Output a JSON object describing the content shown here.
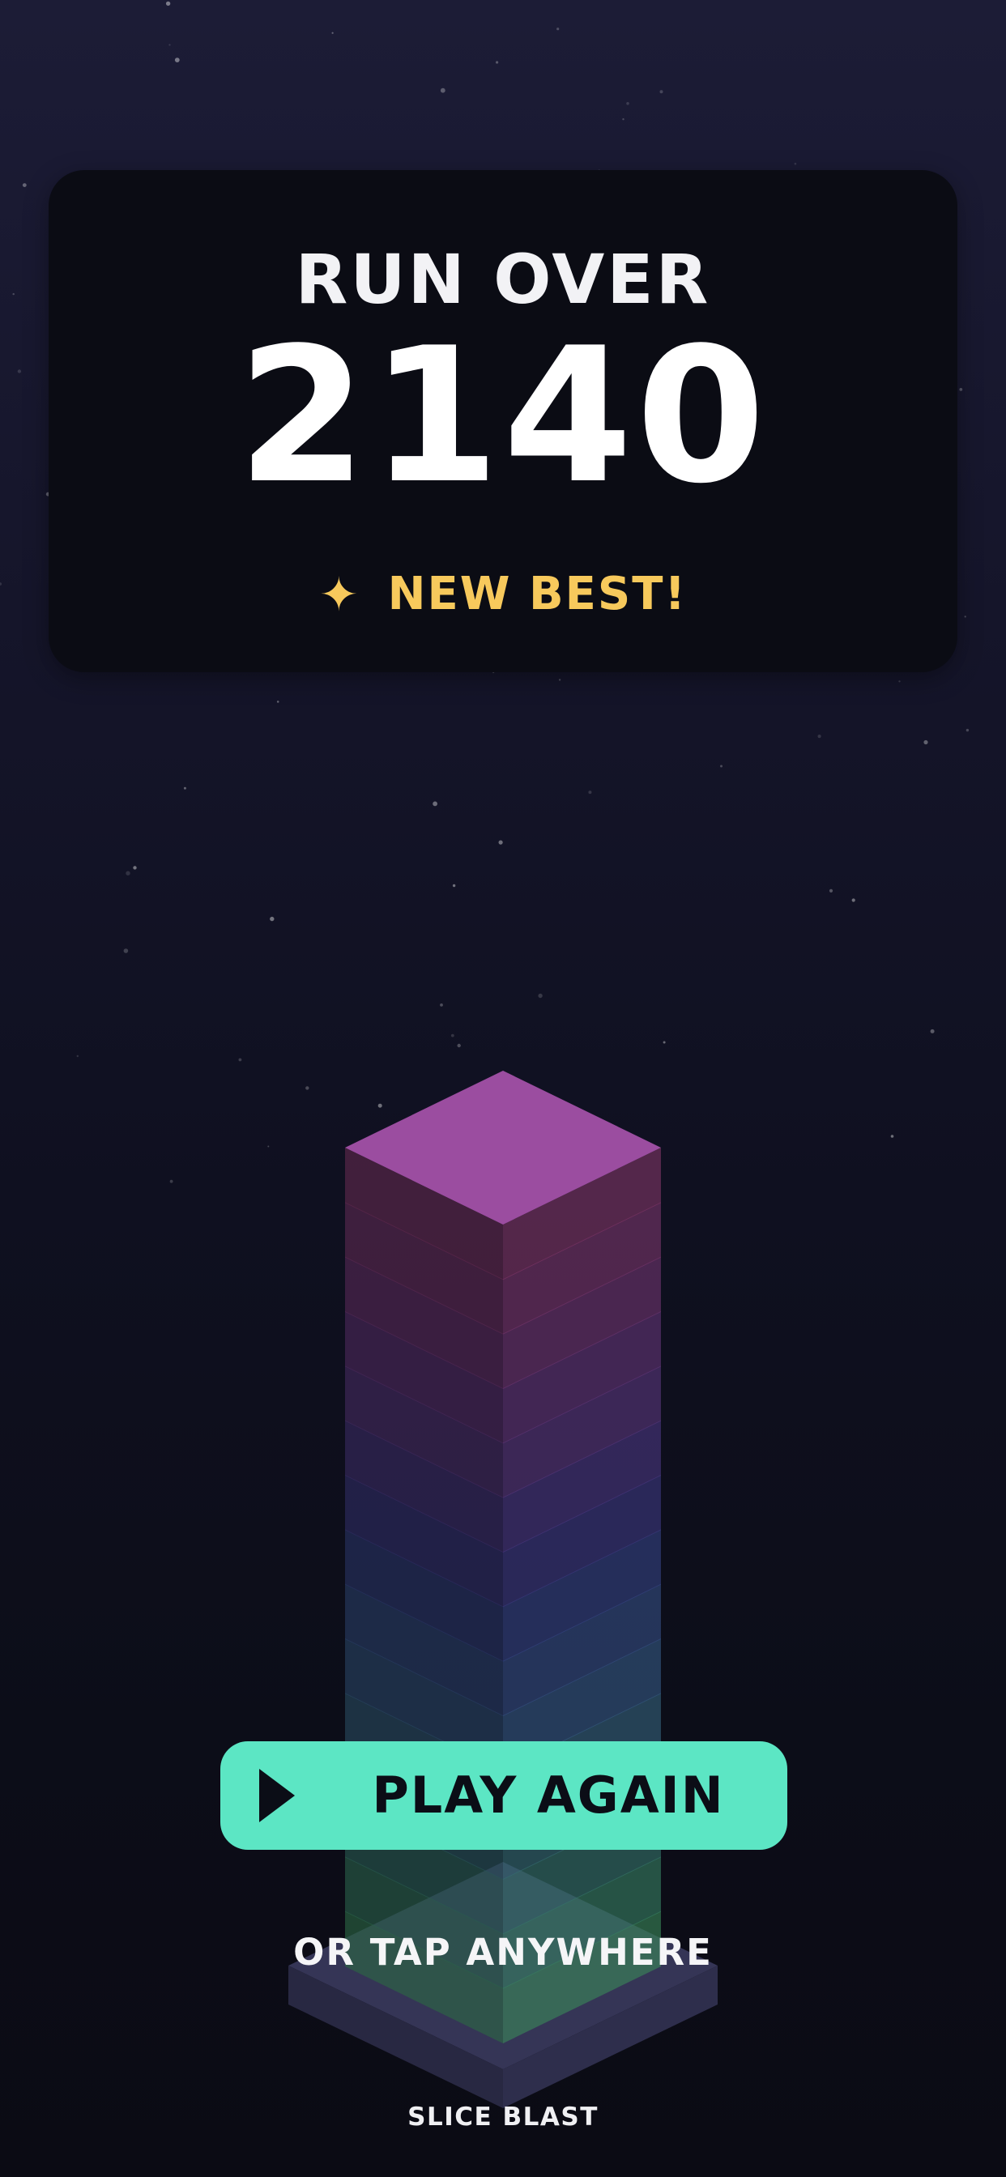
{
  "result_panel": {
    "title": "RUN OVER",
    "score": "2140",
    "badge": {
      "icon": "sparkle-icon",
      "glyph": "✦",
      "text": "NEW BEST!"
    }
  },
  "tower": {
    "top_color": "#9b4da0",
    "layer_colors": [
      "#b04a8e",
      "#a84a94",
      "#9b4b9c",
      "#8a4ba4",
      "#7a4cab",
      "#674db0",
      "#554eb2",
      "#4a5bb4",
      "#4a6cb6",
      "#4a7ab4",
      "#4a88aa",
      "#4a96a0",
      "#4aa394",
      "#4cb088",
      "#50bc7c"
    ],
    "base_color": "#2a2a45"
  },
  "actions": {
    "play_again_label": "PLAY AGAIN",
    "play_icon": "play-icon",
    "tap_hint": "OR TAP ANYWHERE"
  },
  "footer": {
    "brand": "SLICE BLAST"
  },
  "colors": {
    "background_top": "#1c1c36",
    "background_bottom": "#0b0b14",
    "panel": "#0b0c14",
    "accent": "#5ce6c4",
    "gold": "#f7c95c"
  }
}
